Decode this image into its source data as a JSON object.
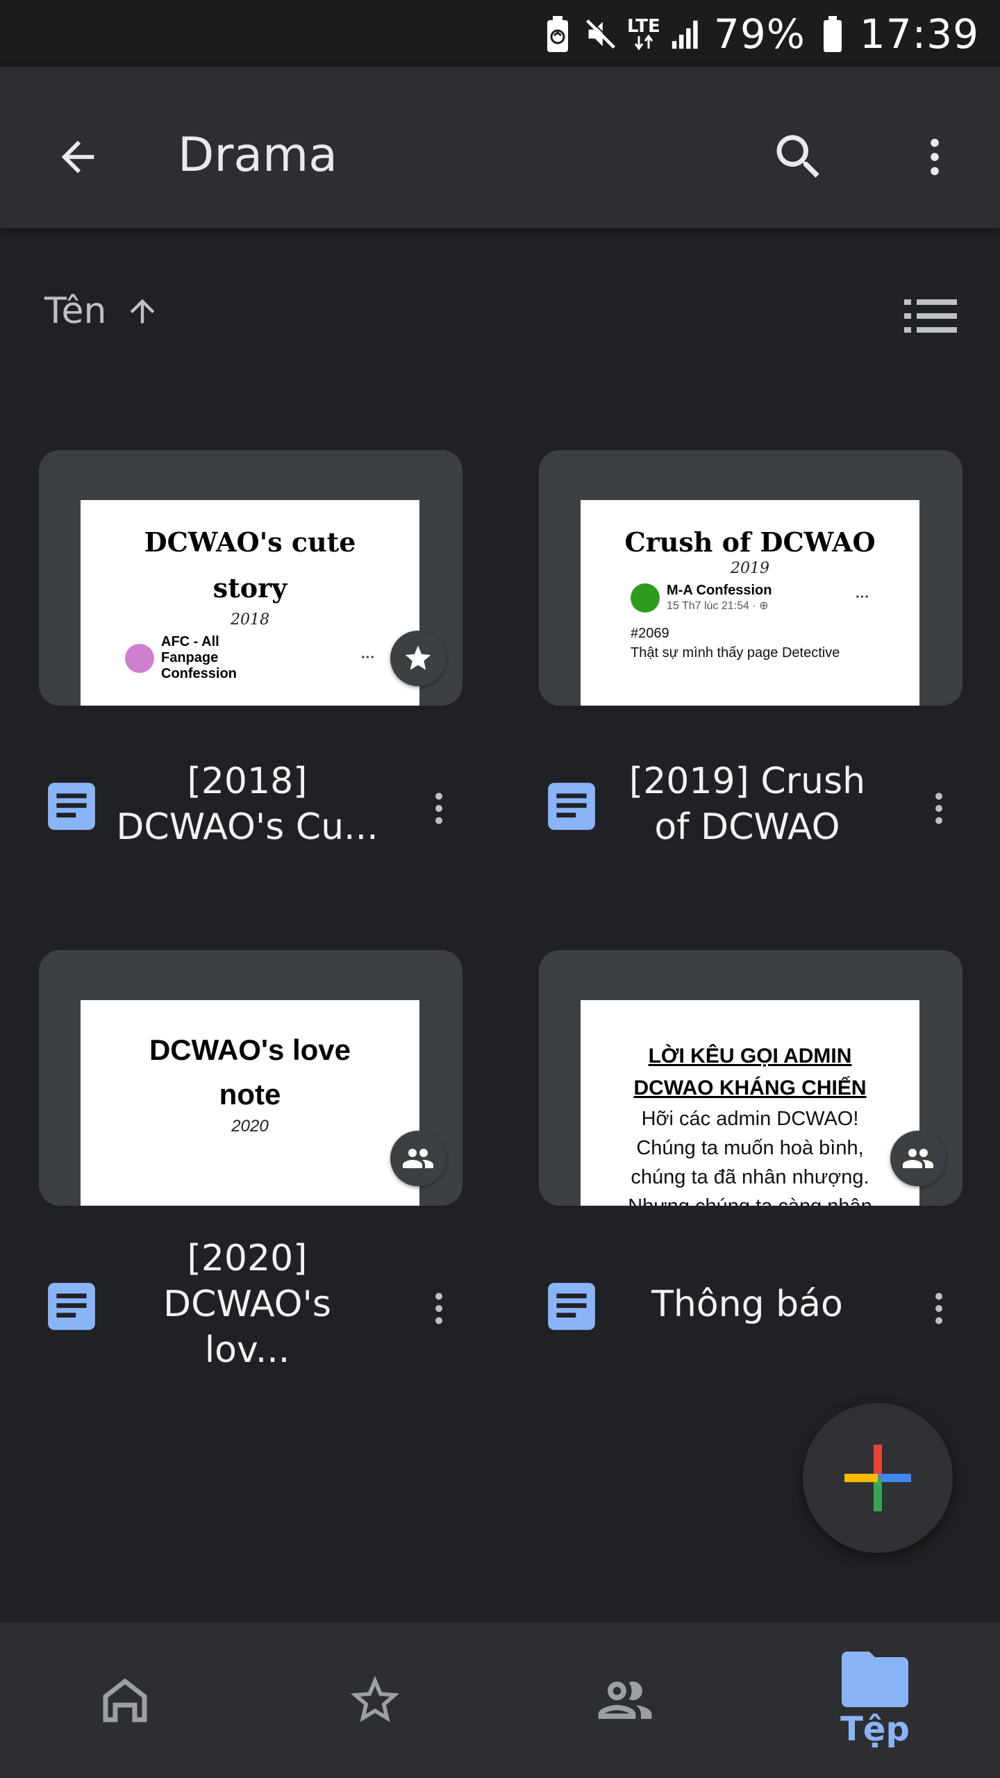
{
  "status_bar": {
    "network": "LTE",
    "battery": "79%",
    "time": "17:39",
    "icons": [
      "battery-saver-icon",
      "mute-icon",
      "lte-icon",
      "signal-icon",
      "battery-icon"
    ]
  },
  "app_bar": {
    "title": "Drama",
    "icons": [
      "back-arrow-icon",
      "search-icon",
      "more-vert-icon"
    ]
  },
  "sort": {
    "label": "Tên",
    "direction_icon": "arrow-up-icon",
    "view_toggle_icon": "list-view-icon"
  },
  "files": [
    {
      "name": "[2018] DCWAO's Cu...",
      "type_icon": "google-docs-icon",
      "badge_icon": "star-icon",
      "preview": {
        "title": "DCWAO's cute story",
        "year": "2018",
        "post_author": "AFC - All Fanpage Confession",
        "post_avatar_color": "#cf7fcf",
        "post_dots": "···"
      }
    },
    {
      "name": "[2019] Crush of DCWAO",
      "type_icon": "google-docs-icon",
      "badge_icon": "",
      "preview": {
        "title": "Crush of DCWAO",
        "year": "2019",
        "post_author": "M-A Confession",
        "post_time": "15 Th7 lúc 21:54 · ⊕",
        "post_avatar_color": "#2e9a1e",
        "post_dots": "···",
        "body_lines": [
          "#2069",
          "Thật sự mình thấy page Detective"
        ]
      }
    },
    {
      "name": "[2020] DCWAO's lov...",
      "type_icon": "google-docs-icon",
      "badge_icon": "shared-people-icon",
      "preview": {
        "title": "DCWAO's love note",
        "year": "2020"
      }
    },
    {
      "name": "Thông báo",
      "type_icon": "google-docs-icon",
      "badge_icon": "shared-people-icon",
      "preview": {
        "heading_lines": [
          "LỜI KÊU GỌI ADMIN",
          "DCWAO KHÁNG CHIẾN"
        ],
        "body_lines": [
          "Hỡi các admin DCWAO!",
          "Chúng ta muốn hoà bình,",
          "chúng ta đã nhân nhượng.",
          "Nhưng chúng ta càng nhân"
        ]
      }
    }
  ],
  "fab": {
    "icon": "google-plus-icon"
  },
  "bottom_nav": {
    "items": [
      {
        "name": "home",
        "icon": "home-icon",
        "label": "",
        "active": false
      },
      {
        "name": "starred",
        "icon": "star-outline-icon",
        "label": "",
        "active": false
      },
      {
        "name": "shared",
        "icon": "people-icon",
        "label": "",
        "active": false
      },
      {
        "name": "files",
        "icon": "folder-icon",
        "label": "Tệp",
        "active": true
      }
    ]
  },
  "colors": {
    "background": "#202124",
    "app_bar": "#2d2e31",
    "card": "#3c4043",
    "accent": "#8ab4f8",
    "docs_blue": "#8ab4f8"
  }
}
